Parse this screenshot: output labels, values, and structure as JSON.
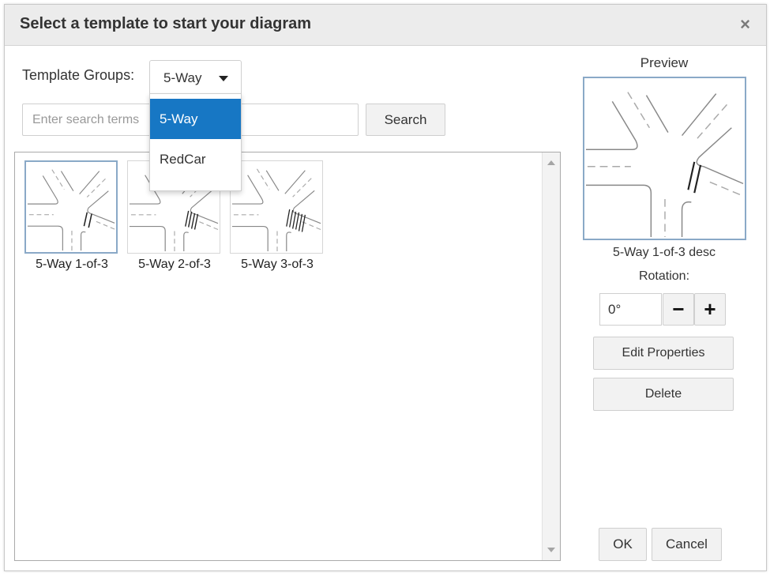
{
  "dialog": {
    "title": "Select a template to start your diagram",
    "close_glyph": "×"
  },
  "template_groups": {
    "label": "Template Groups:",
    "selected": "5-Way",
    "options": [
      "5-Way",
      "RedCar"
    ]
  },
  "search": {
    "placeholder": "Enter search terms",
    "value": "",
    "button_label": "Search"
  },
  "templates": [
    {
      "name": "5-Way 1-of-3",
      "selected": true
    },
    {
      "name": "5-Way 2-of-3",
      "selected": false
    },
    {
      "name": "5-Way 3-of-3",
      "selected": false
    }
  ],
  "preview": {
    "label": "Preview",
    "description": "5-Way 1-of-3 desc",
    "rotation_label": "Rotation:",
    "rotation_value": "0°",
    "minus_glyph": "−",
    "plus_glyph": "+",
    "edit_label": "Edit Properties",
    "delete_label": "Delete"
  },
  "footer": {
    "ok_label": "OK",
    "cancel_label": "Cancel"
  },
  "colors": {
    "dropdown_active": "#1777c4",
    "selected_border": "#8aa9c7"
  }
}
